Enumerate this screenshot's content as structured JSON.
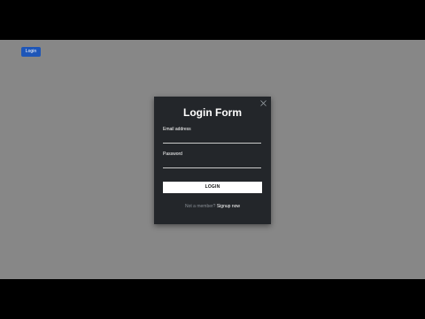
{
  "page": {
    "open_login_label": "Login"
  },
  "modal": {
    "title": "Login Form",
    "email_label": "Email address",
    "email_value": "",
    "password_label": "Password",
    "password_value": "",
    "submit_label": "LOGIN",
    "signup_prompt": "Not a member?",
    "signup_link": "Signup now",
    "close_icon": "close-icon"
  },
  "colors": {
    "backdrop": "#878787",
    "modal_bg": "#23262a",
    "primary_button": "#1e56b8",
    "submit_bg": "#ffffff"
  }
}
